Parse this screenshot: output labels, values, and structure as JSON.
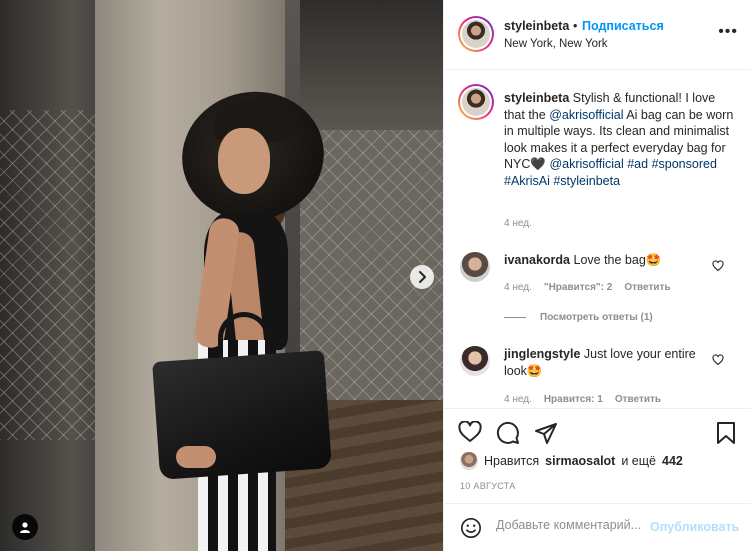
{
  "post": {
    "author": "styleinbeta",
    "follow_label": "Подписаться",
    "separator": "•",
    "location": "New York, New York",
    "more_icon": "more-options-icon"
  },
  "caption": {
    "user": "styleinbeta",
    "text_1": "Stylish & functional! I love that the",
    "mention_1": "@akrisofficial",
    "text_2": "Ai bag can be worn in multiple ways. Its clean and minimalist look makes it a perfect everyday bag for NYC🖤",
    "mention_2": "@akrisofficial",
    "tag_1": "#ad",
    "tag_2": "#sponsored",
    "tag_3": "#AkrisAi",
    "tag_4": "#styleinbeta",
    "time": "4 нед."
  },
  "comments": [
    {
      "user": "ivanakorda",
      "text": "Love the bag🤩",
      "time": "4 нед.",
      "likes": "\"Нравится\": 2",
      "reply": "Ответить",
      "view_replies": "Посмотреть ответы (1)"
    },
    {
      "user": "jinglengstyle",
      "text": "Just love your entire look🤩",
      "time": "4 нед.",
      "likes": "Нравится: 1",
      "reply": "Ответить"
    }
  ],
  "likes": {
    "prefix": "Нравится",
    "user": "sirmaosalot",
    "middle": "и ещё",
    "count": "442"
  },
  "date": "10 АВГУСТА",
  "add_comment": {
    "placeholder": "Добавьте комментарий...",
    "publish_label": "Опубликовать"
  },
  "colors": {
    "accent": "#0095f6",
    "link": "#00376b",
    "muted": "#8e8e8e",
    "publish_disabled": "#b2dffc"
  },
  "icons": [
    "next-arrow-icon",
    "user-tag-icon",
    "heart-icon",
    "comment-icon",
    "share-icon",
    "bookmark-icon",
    "emoji-icon"
  ]
}
